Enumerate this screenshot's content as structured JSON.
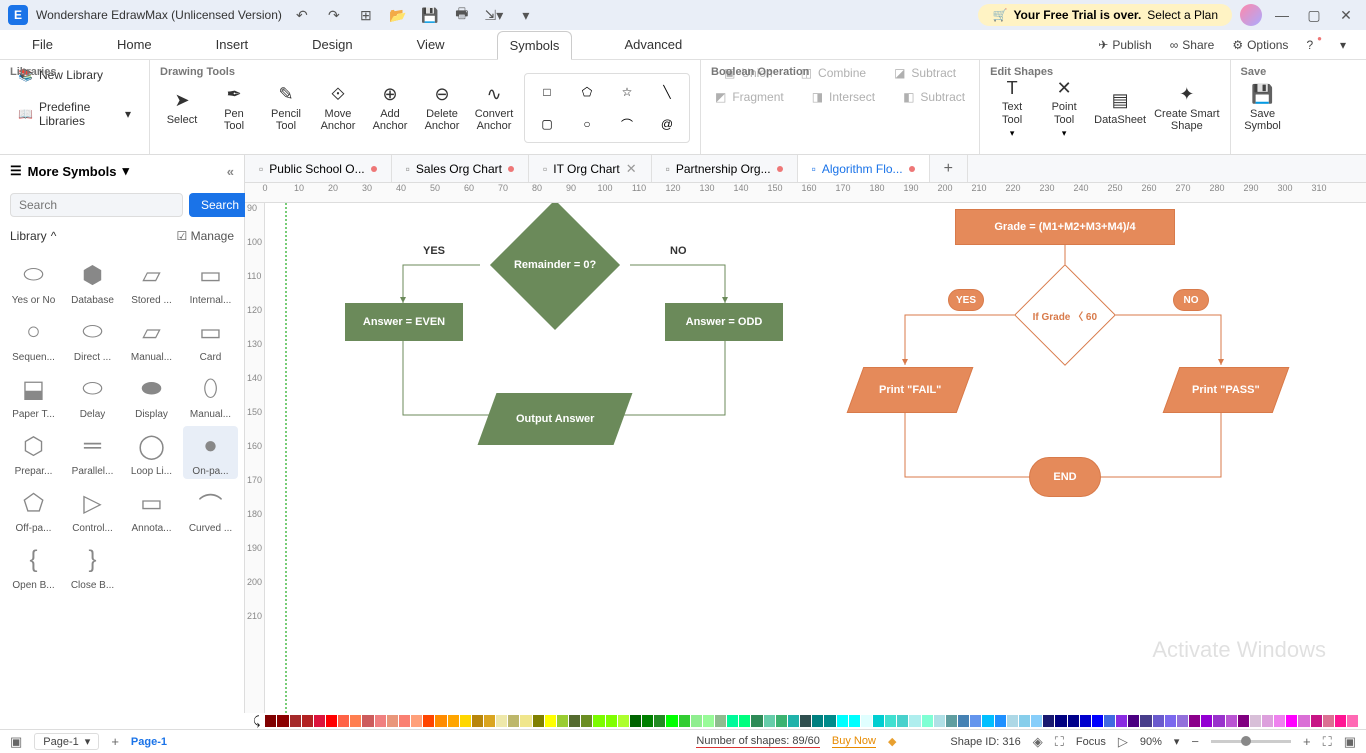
{
  "titlebar": {
    "app_title": "Wondershare EdrawMax (Unlicensed Version)",
    "trial_text_bold": "Your Free Trial is over.",
    "trial_text_rest": " Select a Plan"
  },
  "menubar": {
    "items": [
      "File",
      "Home",
      "Insert",
      "Design",
      "View",
      "Symbols",
      "Advanced"
    ],
    "active": 5,
    "publish": "Publish",
    "share": "Share",
    "options": "Options"
  },
  "ribbon": {
    "libraries": {
      "new_library": "New Library",
      "predefine": "Predefine Libraries",
      "label": "Libraries"
    },
    "drawing_tools": {
      "select": "Select",
      "pen": "Pen\nTool",
      "pencil": "Pencil\nTool",
      "move": "Move\nAnchor",
      "add": "Add\nAnchor",
      "delete": "Delete\nAnchor",
      "convert": "Convert\nAnchor",
      "label": "Drawing Tools"
    },
    "boolean": {
      "union": "Union",
      "combine": "Combine",
      "subtract": "Subtract",
      "fragment": "Fragment",
      "intersect": "Intersect",
      "subtract2": "Subtract",
      "label": "Boolean Operation"
    },
    "edit_shapes": {
      "text_tool": "Text\nTool",
      "point_tool": "Point\nTool",
      "datasheet": "DataSheet",
      "smart": "Create Smart\nShape",
      "label": "Edit Shapes"
    },
    "save": {
      "save_symbol": "Save\nSymbol",
      "label": "Save"
    }
  },
  "left": {
    "more_symbols": "More Symbols",
    "search_btn": "Search",
    "search_placeholder": "Search",
    "library": "Library",
    "manage": "Manage",
    "shapes": [
      "Yes or No",
      "Database",
      "Stored ...",
      "Internal...",
      "Sequen...",
      "Direct ...",
      "Manual...",
      "Card",
      "Paper T...",
      "Delay",
      "Display",
      "Manual...",
      "Prepar...",
      "Parallel...",
      "Loop Li...",
      "On-pa...",
      "Off-pa...",
      "Control...",
      "Annota...",
      "Curved ...",
      "Open B...",
      "Close B..."
    ]
  },
  "tabs": {
    "items": [
      {
        "label": "Public School O...",
        "dirty": true
      },
      {
        "label": "Sales Org Chart",
        "dirty": true
      },
      {
        "label": "IT Org Chart",
        "dirty": false,
        "close": true
      },
      {
        "label": "Partnership Org...",
        "dirty": true
      },
      {
        "label": "Algorithm Flo...",
        "dirty": true,
        "active": true
      }
    ]
  },
  "ruler_start": 0,
  "ruler_end": 310,
  "vruler_start": 90,
  "vruler_end": 210,
  "flowchart": {
    "green": {
      "yes": "YES",
      "no": "NO",
      "decision": "Remainder = 0?",
      "even": "Answer = EVEN",
      "odd": "Answer = ODD",
      "output": "Output Answer"
    },
    "orange": {
      "grade": "Grade =  (M1+M2+M3+M4)/4",
      "yes": "YES",
      "no": "NO",
      "decision": "If Grade 〈 60",
      "fail": "Print \"FAIL\"",
      "pass": "Print \"PASS\"",
      "end": "END"
    }
  },
  "watermark": "Activate Windows",
  "statusbar": {
    "page": "Page-1",
    "page_tab": "Page-1",
    "shapes_count": "Number of shapes: 89/60",
    "buy_now": "Buy Now",
    "shape_id": "Shape ID: 316",
    "focus": "Focus",
    "zoom": "90%"
  },
  "colors": [
    "#800000",
    "#8b0000",
    "#a52a2a",
    "#b22222",
    "#dc143c",
    "#ff0000",
    "#ff6347",
    "#ff7f50",
    "#cd5c5c",
    "#f08080",
    "#e9967a",
    "#fa8072",
    "#ffa07a",
    "#ff4500",
    "#ff8c00",
    "#ffa500",
    "#ffd700",
    "#b8860b",
    "#daa520",
    "#eee8aa",
    "#bdb76b",
    "#f0e68c",
    "#808000",
    "#ffff00",
    "#9acd32",
    "#556b2f",
    "#6b8e23",
    "#7cfc00",
    "#7fff00",
    "#adff2f",
    "#006400",
    "#008000",
    "#228b22",
    "#00ff00",
    "#32cd32",
    "#90ee90",
    "#98fb98",
    "#8fbc8f",
    "#00fa9a",
    "#00ff7f",
    "#2e8b57",
    "#66cdaa",
    "#3cb371",
    "#20b2aa",
    "#2f4f4f",
    "#008080",
    "#008b8b",
    "#00ffff",
    "#00ffff",
    "#e0ffff",
    "#00ced1",
    "#40e0d0",
    "#48d1cc",
    "#afeeee",
    "#7fffd4",
    "#b0e0e6",
    "#5f9ea0",
    "#4682b4",
    "#6495ed",
    "#00bfff",
    "#1e90ff",
    "#add8e6",
    "#87ceeb",
    "#87cefa",
    "#191970",
    "#000080",
    "#00008b",
    "#0000cd",
    "#0000ff",
    "#4169e1",
    "#8a2be2",
    "#4b0082",
    "#483d8b",
    "#6a5acd",
    "#7b68ee",
    "#9370db",
    "#8b008b",
    "#9400d3",
    "#9932cc",
    "#ba55d3",
    "#800080",
    "#d8bfd8",
    "#dda0dd",
    "#ee82ee",
    "#ff00ff",
    "#da70d6",
    "#c71585",
    "#db7093",
    "#ff1493",
    "#ff69b4",
    "#ffb6c1",
    "#ffc0cb",
    "#faebd7",
    "#f5f5dc",
    "#ffe4c4",
    "#ffebcd",
    "#f5deb3",
    "#fff8dc",
    "#fffacd",
    "#fafad2",
    "#ffffe0",
    "#8b4513",
    "#a0522d",
    "#d2691e",
    "#cd853f",
    "#f4a460",
    "#deb887",
    "#d2b48c",
    "#bc8f8f",
    "#ffe4b5",
    "#ffdead",
    "#ffdab9",
    "#ffe4e1",
    "#fff0f5",
    "#faf0e6",
    "#fdf5e6",
    "#ffefd5",
    "#fff5ee",
    "#f5fffa",
    "#708090",
    "#778899",
    "#b0c4de",
    "#e6e6fa",
    "#fffaf0",
    "#f0f8ff",
    "#f8f8ff",
    "#f0fff0",
    "#fffff0",
    "#f0ffff",
    "#fffafa"
  ]
}
